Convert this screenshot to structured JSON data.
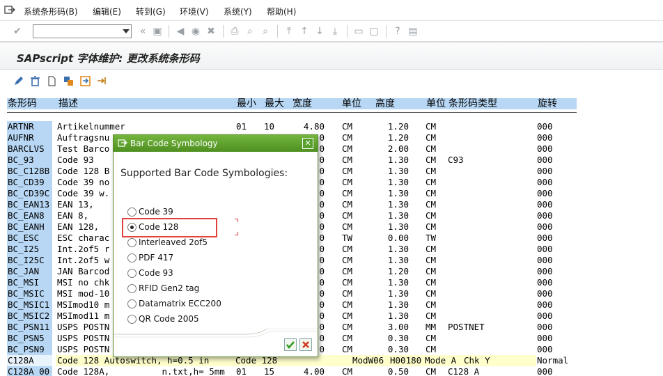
{
  "menu": [
    "系统条形码(B)",
    "编辑(E)",
    "转到(G)",
    "环境(V)",
    "系统(Y)",
    "帮助(H)"
  ],
  "page_title": "SAPscript 字体维护: 更改系统条形码",
  "columns": [
    "条形码",
    "描述",
    "最小",
    "最大",
    "宽度",
    "单位",
    "高度",
    "单位",
    "条形码类型",
    "旋转"
  ],
  "rows": [
    {
      "code": "ARTNR",
      "desc": "Artikelnummer",
      "min": "01",
      "max": "10",
      "width": "4.80",
      "unit": "CM",
      "height": "1.20",
      "hunit": "CM",
      "type": "",
      "rot": "000"
    },
    {
      "code": "AUFNR",
      "desc": "Auftragsnu",
      "min": "",
      "max": "",
      "width": "0",
      "unit": "CM",
      "height": "1.20",
      "hunit": "CM",
      "type": "",
      "rot": "000"
    },
    {
      "code": "BARCLVS",
      "desc": "Test Barco",
      "min": "",
      "max": "",
      "width": "0",
      "unit": "CM",
      "height": "2.00",
      "hunit": "CM",
      "type": "",
      "rot": "000"
    },
    {
      "code": "BC_93",
      "desc": "Code 93",
      "min": "",
      "max": "",
      "width": "0",
      "unit": "CM",
      "height": "1.30",
      "hunit": "CM",
      "type": "C93",
      "rot": "000"
    },
    {
      "code": "BC_C128B",
      "desc": "Code 128 B",
      "min": "",
      "max": "",
      "width": "0",
      "unit": "CM",
      "height": "1.30",
      "hunit": "CM",
      "type": "",
      "rot": "000"
    },
    {
      "code": "BC_CD39",
      "desc": "Code 39 no",
      "min": "",
      "max": "",
      "width": "0",
      "unit": "CM",
      "height": "1.30",
      "hunit": "CM",
      "type": "",
      "rot": "000"
    },
    {
      "code": "BC_CD39C",
      "desc": "Code 39 w.",
      "min": "",
      "max": "",
      "width": "0",
      "unit": "CM",
      "height": "1.30",
      "hunit": "CM",
      "type": "",
      "rot": "000"
    },
    {
      "code": "BC_EAN13",
      "desc": "EAN 13,",
      "min": "",
      "max": "",
      "width": "0",
      "unit": "CM",
      "height": "1.30",
      "hunit": "CM",
      "type": "",
      "rot": "000"
    },
    {
      "code": "BC_EAN8",
      "desc": "EAN 8,",
      "min": "",
      "max": "",
      "width": "0",
      "unit": "CM",
      "height": "1.30",
      "hunit": "CM",
      "type": "",
      "rot": "000"
    },
    {
      "code": "BC_EANH",
      "desc": "EAN 128,",
      "min": "",
      "max": "",
      "width": "0",
      "unit": "CM",
      "height": "1.30",
      "hunit": "CM",
      "type": "",
      "rot": "000"
    },
    {
      "code": "BC_ESC",
      "desc": "ESC charac",
      "min": "",
      "max": "",
      "width": "0",
      "unit": "TW",
      "height": "0.00",
      "hunit": "TW",
      "type": "",
      "rot": "000"
    },
    {
      "code": "BC_I25",
      "desc": "Int.2of5 r",
      "min": "",
      "max": "",
      "width": "0",
      "unit": "CM",
      "height": "1.30",
      "hunit": "CM",
      "type": "",
      "rot": "000"
    },
    {
      "code": "BC_I25C",
      "desc": "Int.2of5 w",
      "min": "",
      "max": "",
      "width": "0",
      "unit": "CM",
      "height": "1.30",
      "hunit": "CM",
      "type": "",
      "rot": "000"
    },
    {
      "code": "BC_JAN",
      "desc": "JAN Barcod",
      "min": "",
      "max": "",
      "width": "0",
      "unit": "CM",
      "height": "1.20",
      "hunit": "CM",
      "type": "",
      "rot": "000"
    },
    {
      "code": "BC_MSI",
      "desc": "MSI no chk",
      "min": "",
      "max": "",
      "width": "0",
      "unit": "CM",
      "height": "1.30",
      "hunit": "CM",
      "type": "",
      "rot": "000"
    },
    {
      "code": "BC_MSIC",
      "desc": "MSI mod-10",
      "min": "",
      "max": "",
      "width": "0",
      "unit": "CM",
      "height": "1.30",
      "hunit": "CM",
      "type": "",
      "rot": "000"
    },
    {
      "code": "BC_MSIC1",
      "desc": "MSImod10 m",
      "min": "",
      "max": "",
      "width": "0",
      "unit": "CM",
      "height": "1.30",
      "hunit": "CM",
      "type": "",
      "rot": "000"
    },
    {
      "code": "BC_MSIC2",
      "desc": "MSImod11 m",
      "min": "",
      "max": "",
      "width": "0",
      "unit": "CM",
      "height": "1.30",
      "hunit": "CM",
      "type": "",
      "rot": "000"
    },
    {
      "code": "BC_PSN11",
      "desc": "USPS POSTN",
      "min": "",
      "max": "",
      "width": "0",
      "unit": "CM",
      "height": "3.00",
      "hunit": "MM",
      "type": "POSTNET",
      "rot": "000"
    },
    {
      "code": "BC_PSN5",
      "desc": "USPS POSTN",
      "min": "",
      "max": "",
      "width": "0",
      "unit": "CM",
      "height": "0.30",
      "hunit": "CM",
      "type": "",
      "rot": "000"
    },
    {
      "code": "BC_PSN9",
      "desc": "USPS POSTN",
      "min": "",
      "max": "",
      "width": "0",
      "unit": "CM",
      "height": "0.30",
      "hunit": "CM",
      "type": "",
      "rot": "000"
    },
    {
      "code": "C128A",
      "desc": "Code 128 Autoswitch, h=0.5 in",
      "min": "Code 128",
      "max": "",
      "width": "",
      "unit": "ModW06",
      "height": "H00180",
      "hunit": "Mode A",
      "type": "Chk Y",
      "rot": "Normal"
    },
    {
      "code": "C128A_00",
      "desc": "Code 128A,          n.txt,h= 5mm",
      "min": "01",
      "max": "15",
      "width": "4.00",
      "unit": "CM",
      "height": "0.50",
      "hunit": "CM",
      "type": "C128 A",
      "rot": "000"
    }
  ],
  "dialog": {
    "title": "Bar Code Symbology",
    "heading": "Supported Bar Code Symbologies:",
    "options": [
      "Code 39",
      "Code 128",
      "Interleaved 2of5",
      "PDF 417",
      "Code 93",
      "RFID Gen2 tag",
      "Datamatrix ECC200",
      "QR Code 2005"
    ],
    "selected": "Code 128"
  },
  "colors": {
    "key_col_bg": "#b7d7f4",
    "dialog_title": "#5d9e2e",
    "highlight": "#e0413a",
    "selected_row": "#ffffcc"
  }
}
